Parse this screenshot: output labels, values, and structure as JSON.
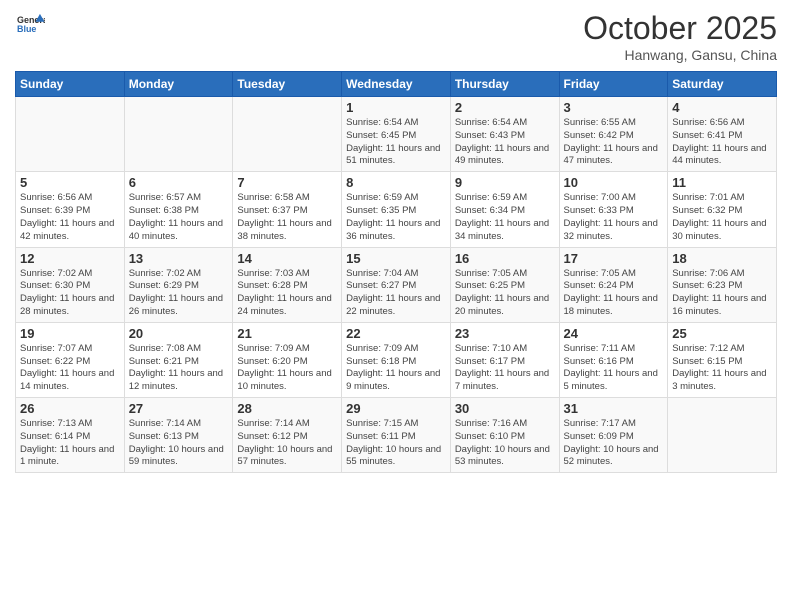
{
  "logo": {
    "general": "General",
    "blue": "Blue"
  },
  "title": "October 2025",
  "subtitle": "Hanwang, Gansu, China",
  "days_of_week": [
    "Sunday",
    "Monday",
    "Tuesday",
    "Wednesday",
    "Thursday",
    "Friday",
    "Saturday"
  ],
  "weeks": [
    [
      {
        "day": "",
        "sunrise": "",
        "sunset": "",
        "daylight": ""
      },
      {
        "day": "",
        "sunrise": "",
        "sunset": "",
        "daylight": ""
      },
      {
        "day": "",
        "sunrise": "",
        "sunset": "",
        "daylight": ""
      },
      {
        "day": "1",
        "sunrise": "Sunrise: 6:54 AM",
        "sunset": "Sunset: 6:45 PM",
        "daylight": "Daylight: 11 hours and 51 minutes."
      },
      {
        "day": "2",
        "sunrise": "Sunrise: 6:54 AM",
        "sunset": "Sunset: 6:43 PM",
        "daylight": "Daylight: 11 hours and 49 minutes."
      },
      {
        "day": "3",
        "sunrise": "Sunrise: 6:55 AM",
        "sunset": "Sunset: 6:42 PM",
        "daylight": "Daylight: 11 hours and 47 minutes."
      },
      {
        "day": "4",
        "sunrise": "Sunrise: 6:56 AM",
        "sunset": "Sunset: 6:41 PM",
        "daylight": "Daylight: 11 hours and 44 minutes."
      }
    ],
    [
      {
        "day": "5",
        "sunrise": "Sunrise: 6:56 AM",
        "sunset": "Sunset: 6:39 PM",
        "daylight": "Daylight: 11 hours and 42 minutes."
      },
      {
        "day": "6",
        "sunrise": "Sunrise: 6:57 AM",
        "sunset": "Sunset: 6:38 PM",
        "daylight": "Daylight: 11 hours and 40 minutes."
      },
      {
        "day": "7",
        "sunrise": "Sunrise: 6:58 AM",
        "sunset": "Sunset: 6:37 PM",
        "daylight": "Daylight: 11 hours and 38 minutes."
      },
      {
        "day": "8",
        "sunrise": "Sunrise: 6:59 AM",
        "sunset": "Sunset: 6:35 PM",
        "daylight": "Daylight: 11 hours and 36 minutes."
      },
      {
        "day": "9",
        "sunrise": "Sunrise: 6:59 AM",
        "sunset": "Sunset: 6:34 PM",
        "daylight": "Daylight: 11 hours and 34 minutes."
      },
      {
        "day": "10",
        "sunrise": "Sunrise: 7:00 AM",
        "sunset": "Sunset: 6:33 PM",
        "daylight": "Daylight: 11 hours and 32 minutes."
      },
      {
        "day": "11",
        "sunrise": "Sunrise: 7:01 AM",
        "sunset": "Sunset: 6:32 PM",
        "daylight": "Daylight: 11 hours and 30 minutes."
      }
    ],
    [
      {
        "day": "12",
        "sunrise": "Sunrise: 7:02 AM",
        "sunset": "Sunset: 6:30 PM",
        "daylight": "Daylight: 11 hours and 28 minutes."
      },
      {
        "day": "13",
        "sunrise": "Sunrise: 7:02 AM",
        "sunset": "Sunset: 6:29 PM",
        "daylight": "Daylight: 11 hours and 26 minutes."
      },
      {
        "day": "14",
        "sunrise": "Sunrise: 7:03 AM",
        "sunset": "Sunset: 6:28 PM",
        "daylight": "Daylight: 11 hours and 24 minutes."
      },
      {
        "day": "15",
        "sunrise": "Sunrise: 7:04 AM",
        "sunset": "Sunset: 6:27 PM",
        "daylight": "Daylight: 11 hours and 22 minutes."
      },
      {
        "day": "16",
        "sunrise": "Sunrise: 7:05 AM",
        "sunset": "Sunset: 6:25 PM",
        "daylight": "Daylight: 11 hours and 20 minutes."
      },
      {
        "day": "17",
        "sunrise": "Sunrise: 7:05 AM",
        "sunset": "Sunset: 6:24 PM",
        "daylight": "Daylight: 11 hours and 18 minutes."
      },
      {
        "day": "18",
        "sunrise": "Sunrise: 7:06 AM",
        "sunset": "Sunset: 6:23 PM",
        "daylight": "Daylight: 11 hours and 16 minutes."
      }
    ],
    [
      {
        "day": "19",
        "sunrise": "Sunrise: 7:07 AM",
        "sunset": "Sunset: 6:22 PM",
        "daylight": "Daylight: 11 hours and 14 minutes."
      },
      {
        "day": "20",
        "sunrise": "Sunrise: 7:08 AM",
        "sunset": "Sunset: 6:21 PM",
        "daylight": "Daylight: 11 hours and 12 minutes."
      },
      {
        "day": "21",
        "sunrise": "Sunrise: 7:09 AM",
        "sunset": "Sunset: 6:20 PM",
        "daylight": "Daylight: 11 hours and 10 minutes."
      },
      {
        "day": "22",
        "sunrise": "Sunrise: 7:09 AM",
        "sunset": "Sunset: 6:18 PM",
        "daylight": "Daylight: 11 hours and 9 minutes."
      },
      {
        "day": "23",
        "sunrise": "Sunrise: 7:10 AM",
        "sunset": "Sunset: 6:17 PM",
        "daylight": "Daylight: 11 hours and 7 minutes."
      },
      {
        "day": "24",
        "sunrise": "Sunrise: 7:11 AM",
        "sunset": "Sunset: 6:16 PM",
        "daylight": "Daylight: 11 hours and 5 minutes."
      },
      {
        "day": "25",
        "sunrise": "Sunrise: 7:12 AM",
        "sunset": "Sunset: 6:15 PM",
        "daylight": "Daylight: 11 hours and 3 minutes."
      }
    ],
    [
      {
        "day": "26",
        "sunrise": "Sunrise: 7:13 AM",
        "sunset": "Sunset: 6:14 PM",
        "daylight": "Daylight: 11 hours and 1 minute."
      },
      {
        "day": "27",
        "sunrise": "Sunrise: 7:14 AM",
        "sunset": "Sunset: 6:13 PM",
        "daylight": "Daylight: 10 hours and 59 minutes."
      },
      {
        "day": "28",
        "sunrise": "Sunrise: 7:14 AM",
        "sunset": "Sunset: 6:12 PM",
        "daylight": "Daylight: 10 hours and 57 minutes."
      },
      {
        "day": "29",
        "sunrise": "Sunrise: 7:15 AM",
        "sunset": "Sunset: 6:11 PM",
        "daylight": "Daylight: 10 hours and 55 minutes."
      },
      {
        "day": "30",
        "sunrise": "Sunrise: 7:16 AM",
        "sunset": "Sunset: 6:10 PM",
        "daylight": "Daylight: 10 hours and 53 minutes."
      },
      {
        "day": "31",
        "sunrise": "Sunrise: 7:17 AM",
        "sunset": "Sunset: 6:09 PM",
        "daylight": "Daylight: 10 hours and 52 minutes."
      },
      {
        "day": "",
        "sunrise": "",
        "sunset": "",
        "daylight": ""
      }
    ]
  ]
}
